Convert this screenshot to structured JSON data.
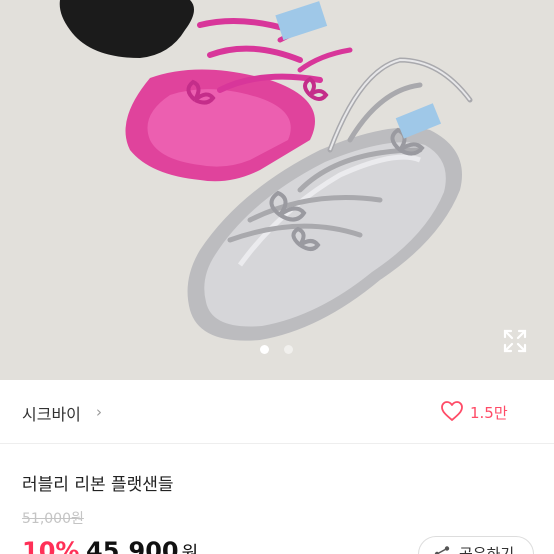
{
  "product_image": {
    "alt": "",
    "pagination": {
      "current": 1,
      "total": 2
    }
  },
  "seller": {
    "name": "시크바이",
    "chevron": "›"
  },
  "like": {
    "count": "1.5만",
    "icon": "heart-outline-icon"
  },
  "product": {
    "title": "러블리 리본 플랫샌들",
    "original_price": "51,000원",
    "discount": "10%",
    "sale_price": "45,900",
    "sale_unit": "원"
  },
  "share": {
    "label": "공유하기",
    "icon": "share-icon"
  },
  "colors": {
    "accent": "#ff3057",
    "like": "#ff4b67",
    "muted": "#c4c4c4"
  }
}
